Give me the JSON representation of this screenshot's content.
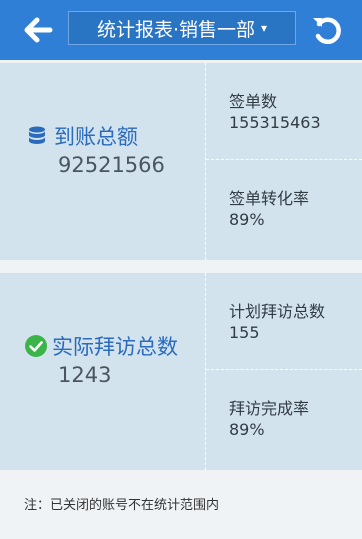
{
  "header": {
    "title": "统计报表·销售一部",
    "caret": "▾"
  },
  "card1": {
    "main_label": "到账总额",
    "main_value": "92521566",
    "stat1_label": "签单数",
    "stat1_value": "155315463",
    "stat2_label": "签单转化率",
    "stat2_value": "89%"
  },
  "card2": {
    "main_label": "实际拜访总数",
    "main_value": "1243",
    "stat1_label": "计划拜访总数",
    "stat1_value": "155",
    "stat2_label": "拜访完成率",
    "stat2_value": "89%"
  },
  "note": "注：已关闭的账号不在统计范围内",
  "colors": {
    "header": "#2f7fd6",
    "card": "#d3e3ee",
    "accent_blue": "#2a6bbd",
    "check_green": "#3bb54a"
  }
}
